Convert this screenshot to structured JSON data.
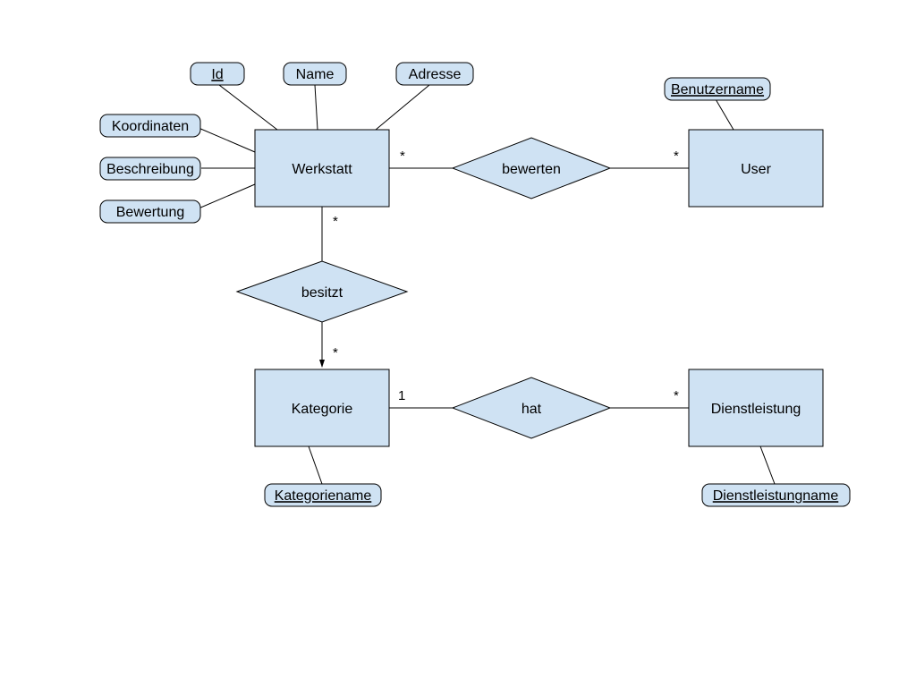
{
  "entities": {
    "werkstatt": "Werkstatt",
    "user": "User",
    "kategorie": "Kategorie",
    "dienstleistung": "Dienstleistung"
  },
  "attributes": {
    "id": "Id",
    "name": "Name",
    "adresse": "Adresse",
    "koordinaten": "Koordinaten",
    "beschreibung": "Beschreibung",
    "bewertung": "Bewertung",
    "benutzername": "Benutzername",
    "kategoriename": "Kategoriename",
    "dienstleistungname": "Dienstleistungname"
  },
  "relationships": {
    "bewerten": "bewerten",
    "besitzt": "besitzt",
    "hat": "hat"
  },
  "cardinalities": {
    "werkstatt_bewerten": "*",
    "user_bewerten": "*",
    "werkstatt_besitzt": "*",
    "kategorie_besitzt": "*",
    "kategorie_hat": "1",
    "dienstleistung_hat": "*"
  }
}
